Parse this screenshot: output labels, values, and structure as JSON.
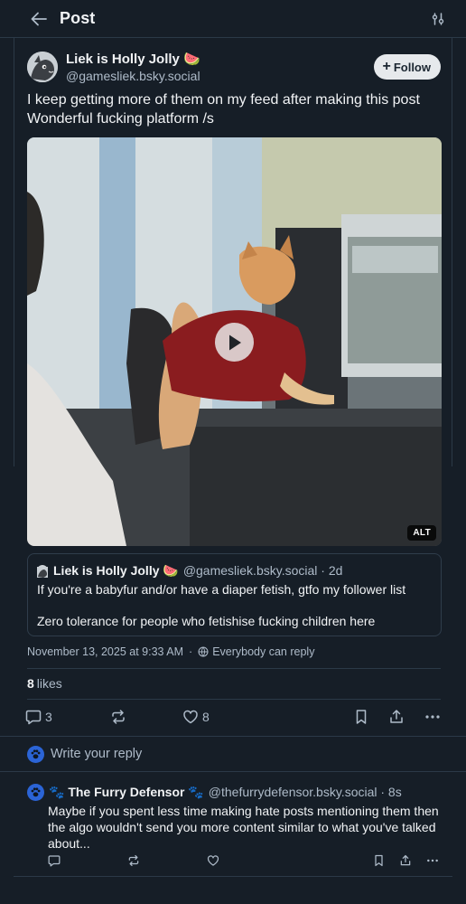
{
  "header": {
    "title": "Post",
    "back_icon": "arrow-left-icon",
    "filter_icon": "sliders-icon"
  },
  "post": {
    "author_name": "Liek is Holly Jolly 🍉",
    "author_handle": "@gamesliek.bsky.social",
    "follow_label": "Follow",
    "text_line1": "I keep getting more of them on my feed after making this post",
    "text_line2": "Wonderful fucking platform /s",
    "video_alt_badge": "ALT",
    "timestamp": "November 13, 2025 at 9:33 AM",
    "reply_setting": "Everybody can reply",
    "likes_count": "8",
    "likes_label": "likes",
    "reply_count": "3",
    "like_count": "8"
  },
  "quote": {
    "author_name": "Liek is Holly Jolly 🍉",
    "author_handle": "@gamesliek.bsky.social · 2d",
    "text_para1": "If you're a babyfur and/or have a diaper fetish, gtfo my follower list",
    "text_para2": "Zero tolerance for people who fetishise fucking children here"
  },
  "composer": {
    "placeholder": "Write your reply"
  },
  "reply": {
    "author_name": "🐾 The Furry Defensor 🐾",
    "author_handle": "@thefurrydefensor.bsky.social · 8s",
    "text": "Maybe if you spent less time making hate posts mentioning them then the algo wouldn't send you more content similar to what you've talked about..."
  },
  "colors": {
    "background": "#161e27",
    "border": "#2b3947",
    "muted_text": "#aebbc9",
    "accent_avatar": "#2b64d6"
  }
}
